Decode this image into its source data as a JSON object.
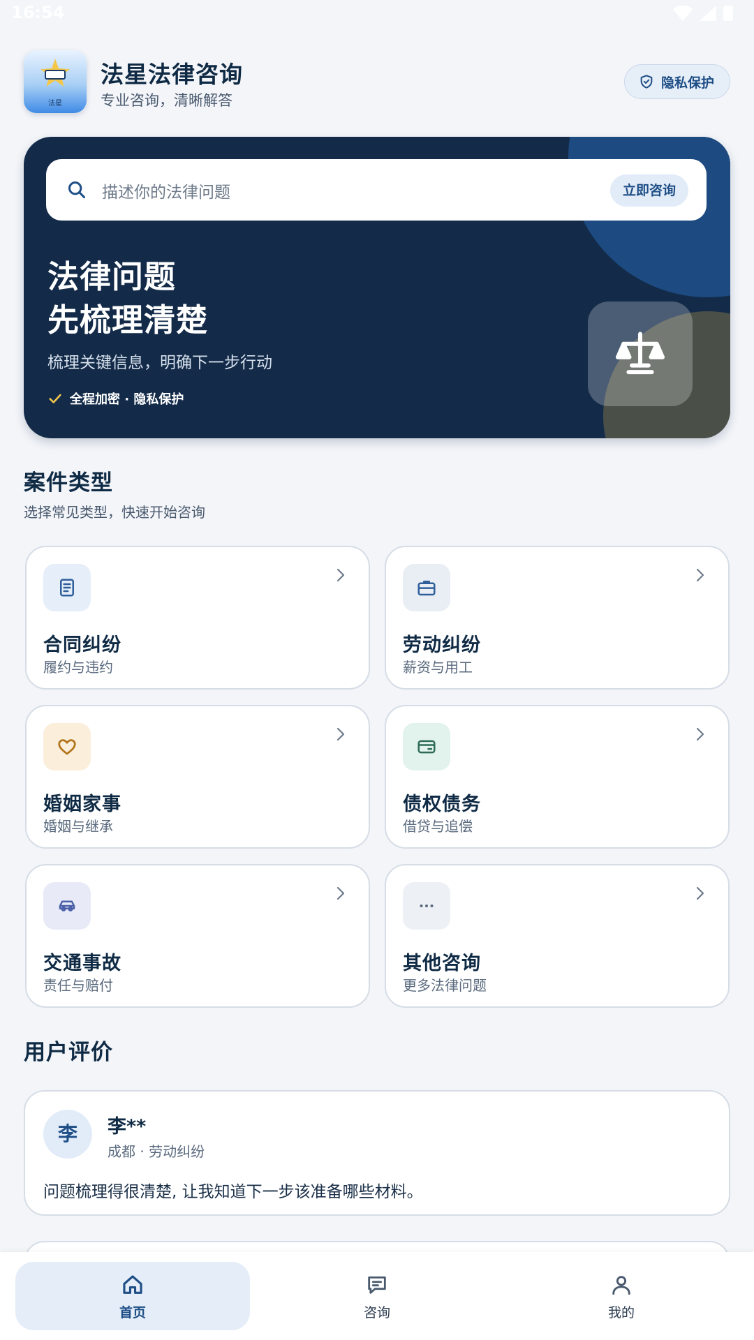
{
  "status": {
    "time": "16:54"
  },
  "header": {
    "logo_text": "法星",
    "app_name": "法星法律咨询",
    "tagline": "专业咨询，清晰解答",
    "privacy_button": "隐私保护"
  },
  "hero": {
    "search_placeholder": "描述你的法律问题",
    "consult_button": "立即咨询",
    "title_line1": "法律问题",
    "title_line2": "先梳理清楚",
    "description": "梳理关键信息，明确下一步行动",
    "security_tag": "全程加密 · 隐私保护"
  },
  "categories": {
    "title": "案件类型",
    "subtitle": "选择常见类型，快速开始咨询",
    "items": [
      {
        "title": "合同纠纷",
        "sub": "履约与违约",
        "icon": "document-icon",
        "color": "#2f5f9a",
        "bg": "#e6eef9"
      },
      {
        "title": "劳动纠纷",
        "sub": "薪资与用工",
        "icon": "briefcase-icon",
        "color": "#2f5f9a",
        "bg": "#e9eef4"
      },
      {
        "title": "婚姻家事",
        "sub": "婚姻与继承",
        "icon": "heart-icon",
        "color": "#b3741b",
        "bg": "#fbefdc"
      },
      {
        "title": "债权债务",
        "sub": "借贷与追偿",
        "icon": "wallet-icon",
        "color": "#2e6b57",
        "bg": "#e2f2ec"
      },
      {
        "title": "交通事故",
        "sub": "责任与赔付",
        "icon": "car-icon",
        "color": "#4a5fa8",
        "bg": "#e8ebf7"
      },
      {
        "title": "其他咨询",
        "sub": "更多法律问题",
        "icon": "more-icon",
        "color": "#5a6a7e",
        "bg": "#edf0f4"
      }
    ]
  },
  "reviews": {
    "title": "用户评价",
    "items": [
      {
        "avatar": "李",
        "name": "李**",
        "meta": "成都 · 劳动纠纷",
        "text": "问题梳理得很清楚, 让我知道下一步该准备哪些材料。"
      }
    ]
  },
  "nav": {
    "items": [
      {
        "label": "首页",
        "icon": "home-icon",
        "active": true
      },
      {
        "label": "咨询",
        "icon": "chat-icon",
        "active": false
      },
      {
        "label": "我的",
        "icon": "user-icon",
        "active": false
      }
    ]
  },
  "colors": {
    "primary": "#1e4e86",
    "hero_bg": "#132b49",
    "accent_check": "#f3c84a"
  }
}
